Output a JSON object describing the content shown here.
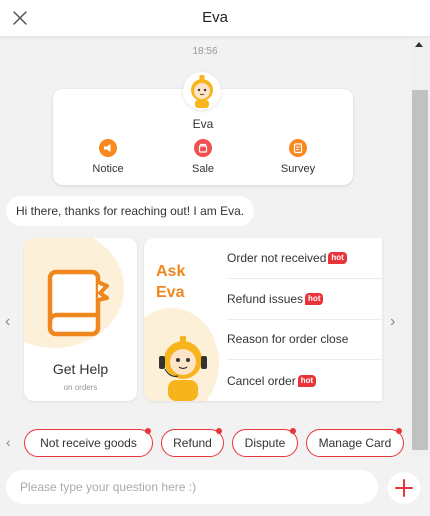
{
  "header": {
    "title": "Eva"
  },
  "chat": {
    "timestamp": "18:56",
    "profile": {
      "name": "Eva",
      "features": [
        {
          "label": "Notice",
          "icon": "megaphone-icon",
          "color": "#f7891f"
        },
        {
          "label": "Sale",
          "icon": "gift-icon",
          "color": "#f25050"
        },
        {
          "label": "Survey",
          "icon": "clipboard-icon",
          "color": "#f7891f"
        }
      ]
    },
    "greeting": "Hi there, thanks for reaching out! I am Eva.",
    "help_card": {
      "title": "Get Help",
      "subtitle": "on orders"
    },
    "faq_card": {
      "ask_line1": "Ask",
      "ask_line2": "Eva",
      "items": [
        {
          "label": "Order not received",
          "badge": "hot"
        },
        {
          "label": "Refund issues",
          "badge": "hot"
        },
        {
          "label": "Reason for order close",
          "badge": ""
        },
        {
          "label": "Cancel order",
          "badge": "hot"
        }
      ]
    }
  },
  "quick_replies": [
    "Not receive goods",
    "Refund",
    "Dispute",
    "Manage Card"
  ],
  "input": {
    "placeholder": "Please type your question here :)"
  },
  "colors": {
    "accent": "#e8343a",
    "brand_orange": "#f0861e"
  }
}
